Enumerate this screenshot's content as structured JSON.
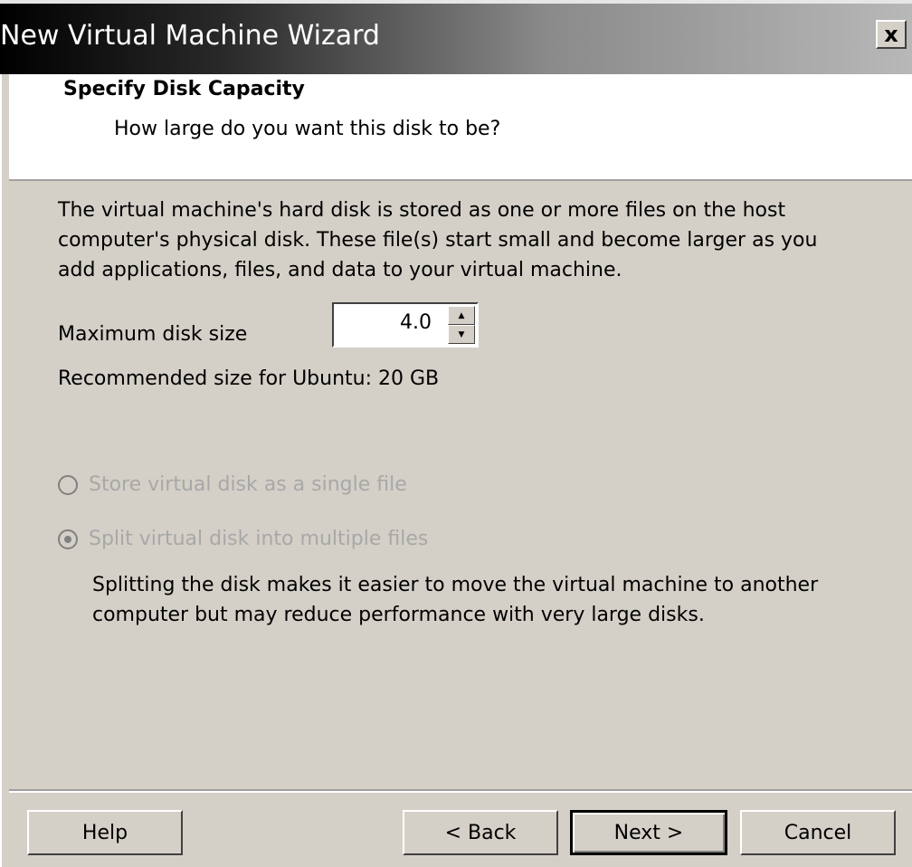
{
  "window": {
    "title": "New Virtual Machine Wizard",
    "close_label": "x"
  },
  "header": {
    "title": "Specify Disk Capacity",
    "subtitle": "How large do you want this disk to be?"
  },
  "description": "The virtual machine's hard disk is stored as one or more files on the host computer's physical disk. These file(s) start small and become larger as you add applications, files, and data to your virtual machine.",
  "disk_size": {
    "label": "Maximum disk size",
    "value": "4.0"
  },
  "recommendation": "Recommended size for Ubuntu: 20 GB",
  "options": [
    {
      "label": "Store virtual disk as a single file",
      "checked": false,
      "enabled": false
    },
    {
      "label": "Split virtual disk into multiple files",
      "checked": true,
      "enabled": false
    }
  ],
  "split_description": "Splitting the disk makes it easier to move the virtual machine to another computer but may reduce performance with very large disks.",
  "buttons": {
    "help": "Help",
    "back": "< Back",
    "next": "Next >",
    "cancel": "Cancel"
  },
  "colors": {
    "dialog_bg": "#d4d0c8",
    "disabled_text": "#a8a8a8"
  }
}
